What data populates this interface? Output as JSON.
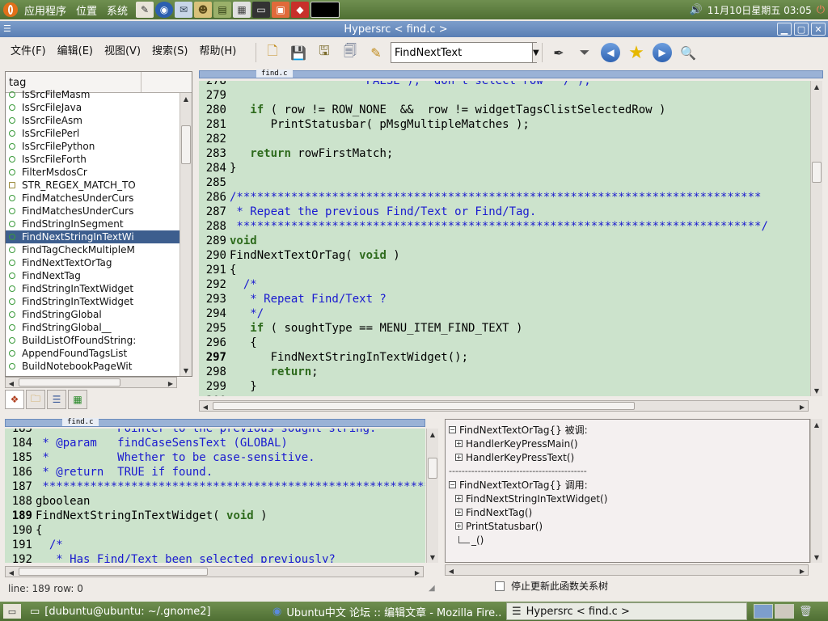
{
  "top_panel": {
    "menus": [
      "应用程序",
      "位置",
      "系统"
    ],
    "clock": "11月10日星期五 03:05"
  },
  "window": {
    "title": "Hypersrc < find.c >"
  },
  "menubar": {
    "items": [
      "文件(F)",
      "编辑(E)",
      "视图(V)",
      "搜索(S)",
      "帮助(H)"
    ]
  },
  "toolbar": {
    "search_value": "FindNextText"
  },
  "tag_panel": {
    "header": "tag",
    "items": [
      {
        "label": "IsSrcFileMasm",
        "kind": "function"
      },
      {
        "label": "IsSrcFileJava",
        "kind": "function"
      },
      {
        "label": "IsSrcFileAsm",
        "kind": "function"
      },
      {
        "label": "IsSrcFilePerl",
        "kind": "function"
      },
      {
        "label": "IsSrcFilePython",
        "kind": "function"
      },
      {
        "label": "IsSrcFileForth",
        "kind": "function"
      },
      {
        "label": "FilterMsdosCr",
        "kind": "function"
      },
      {
        "label": "STR_REGEX_MATCH_TO",
        "kind": "macro"
      },
      {
        "label": "FindMatchesUnderCurs",
        "kind": "function"
      },
      {
        "label": "FindMatchesUnderCurs",
        "kind": "function"
      },
      {
        "label": "FindStringInSegment",
        "kind": "function"
      },
      {
        "label": "FindNextStringInTextWi",
        "kind": "function",
        "selected": true
      },
      {
        "label": "FindTagCheckMultipleM",
        "kind": "function"
      },
      {
        "label": "FindNextTextOrTag",
        "kind": "function"
      },
      {
        "label": "FindNextTag",
        "kind": "function"
      },
      {
        "label": "FindStringInTextWidget",
        "kind": "function"
      },
      {
        "label": "FindStringInTextWidget",
        "kind": "function"
      },
      {
        "label": "FindStringGlobal",
        "kind": "function"
      },
      {
        "label": "FindStringGlobal__",
        "kind": "function"
      },
      {
        "label": "BuildListOfFoundString:",
        "kind": "function"
      },
      {
        "label": "AppendFoundTagsList",
        "kind": "function"
      },
      {
        "label": "BuildNotebookPageWit",
        "kind": "function"
      }
    ]
  },
  "main_editor": {
    "tab_label": "find.c",
    "lines": [
      {
        "n": "278",
        "parts": [
          {
            "c": "cm",
            "t": "                    FALSE );  don't select row  */ );"
          }
        ]
      },
      {
        "n": "279",
        "parts": []
      },
      {
        "n": "280",
        "parts": [
          {
            "c": "tx",
            "t": "   "
          },
          {
            "c": "kw",
            "t": "if"
          },
          {
            "c": "tx",
            "t": " ( row != ROW_NONE  &&  row != widgetTagsClistSelectedRow )"
          }
        ]
      },
      {
        "n": "281",
        "parts": [
          {
            "c": "tx",
            "t": "      PrintStatusbar( pMsgMultipleMatches );"
          }
        ]
      },
      {
        "n": "282",
        "parts": []
      },
      {
        "n": "283",
        "parts": [
          {
            "c": "tx",
            "t": "   "
          },
          {
            "c": "kw",
            "t": "return"
          },
          {
            "c": "tx",
            "t": " rowFirstMatch;"
          }
        ]
      },
      {
        "n": "284",
        "parts": [
          {
            "c": "tx",
            "t": "}"
          }
        ]
      },
      {
        "n": "285",
        "parts": []
      },
      {
        "n": "286",
        "parts": [
          {
            "c": "cm",
            "t": "/*****************************************************************************"
          }
        ]
      },
      {
        "n": "287",
        "parts": [
          {
            "c": "cm",
            "t": " * Repeat the previous Find/Text or Find/Tag."
          }
        ]
      },
      {
        "n": "288",
        "parts": [
          {
            "c": "cm",
            "t": " *****************************************************************************/"
          }
        ]
      },
      {
        "n": "289",
        "parts": [
          {
            "c": "kw",
            "t": "void"
          }
        ]
      },
      {
        "n": "290",
        "parts": [
          {
            "c": "tx",
            "t": "FindNextTextOrTag( "
          },
          {
            "c": "kw",
            "t": "void"
          },
          {
            "c": "tx",
            "t": " )"
          }
        ]
      },
      {
        "n": "291",
        "parts": [
          {
            "c": "tx",
            "t": "{"
          }
        ]
      },
      {
        "n": "292",
        "parts": [
          {
            "c": "cm",
            "t": "  /*"
          }
        ]
      },
      {
        "n": "293",
        "parts": [
          {
            "c": "cm",
            "t": "   * Repeat Find/Text ?"
          }
        ]
      },
      {
        "n": "294",
        "parts": [
          {
            "c": "cm",
            "t": "   */"
          }
        ]
      },
      {
        "n": "295",
        "parts": [
          {
            "c": "tx",
            "t": "   "
          },
          {
            "c": "kw",
            "t": "if"
          },
          {
            "c": "tx",
            "t": " ( soughtType == MENU_ITEM_FIND_TEXT )"
          }
        ]
      },
      {
        "n": "296",
        "parts": [
          {
            "c": "tx",
            "t": "   {"
          }
        ]
      },
      {
        "n": "297",
        "current": true,
        "parts": [
          {
            "c": "tx",
            "t": "      FindNextStringInTextWidget();"
          }
        ]
      },
      {
        "n": "298",
        "parts": [
          {
            "c": "tx",
            "t": "      "
          },
          {
            "c": "kw",
            "t": "return"
          },
          {
            "c": "tx",
            "t": ";"
          }
        ]
      },
      {
        "n": "299",
        "parts": [
          {
            "c": "tx",
            "t": "   }"
          }
        ]
      },
      {
        "n": "300",
        "parts": []
      }
    ]
  },
  "secondary_editor": {
    "tab_label": "find.c",
    "lines": [
      {
        "n": "183",
        "parts": [
          {
            "c": "cm",
            "t": " *          Pointer to the previous sought string."
          }
        ]
      },
      {
        "n": "184",
        "parts": [
          {
            "c": "cm",
            "t": " * @param   findCaseSensText (GLOBAL)"
          }
        ]
      },
      {
        "n": "185",
        "parts": [
          {
            "c": "cm",
            "t": " *          Whether to be case-sensitive."
          }
        ]
      },
      {
        "n": "186",
        "parts": [
          {
            "c": "cm",
            "t": " * @return  TRUE if found."
          }
        ]
      },
      {
        "n": "187",
        "parts": [
          {
            "c": "cm",
            "t": " *****************************************************************************/"
          }
        ]
      },
      {
        "n": "188",
        "parts": [
          {
            "c": "tx",
            "t": "gboolean"
          }
        ]
      },
      {
        "n": "189",
        "current": true,
        "parts": [
          {
            "c": "tx",
            "t": "FindNextStringInTextWidget( "
          },
          {
            "c": "kw",
            "t": "void"
          },
          {
            "c": "tx",
            "t": " )"
          }
        ]
      },
      {
        "n": "190",
        "parts": [
          {
            "c": "tx",
            "t": "{"
          }
        ]
      },
      {
        "n": "191",
        "parts": [
          {
            "c": "cm",
            "t": "  /*"
          }
        ]
      },
      {
        "n": "192",
        "parts": [
          {
            "c": "cm",
            "t": "   * Has Find/Text been selected previously?"
          }
        ]
      }
    ]
  },
  "tree": {
    "called_by_header": "FindNextTextOrTag{} 被调:",
    "called_by": [
      "HandlerKeyPressMain()",
      "HandlerKeyPressText()"
    ],
    "separator": "-------------------------------------------",
    "calls_header": "FindNextTextOrTag{} 调用:",
    "calls": [
      "FindNextStringInTextWidget()",
      "FindNextTag()",
      "PrintStatusbar()",
      "_()"
    ]
  },
  "freeze_checkbox_label": "停止更新此函数关系树",
  "status": "line: 189 row: 0",
  "taskbar": {
    "tasks": [
      {
        "label": "[dubuntu@ubuntu: ~/.gnome2]",
        "active": false
      },
      {
        "label": "Ubuntu中文 论坛 :: 编辑文章 - Mozilla Fire...",
        "active": false
      },
      {
        "label": "Hypersrc < find.c >",
        "active": true
      }
    ]
  }
}
